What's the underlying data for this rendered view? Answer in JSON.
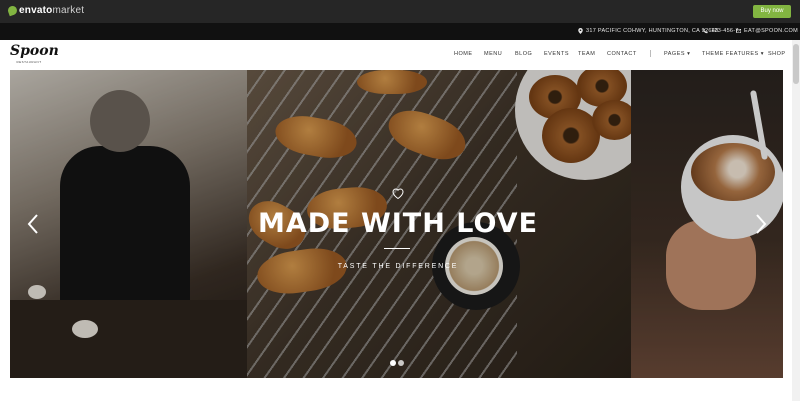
{
  "envato": {
    "brand": "envato",
    "market": "market",
    "buy_label": "Buy now",
    "brand_color": "#82b541"
  },
  "info": {
    "address": "317 PACIFIC COHWY, HUNTINGTON, CA 92648",
    "phone": "123-456-7",
    "email": "EAT@SPOON.COM"
  },
  "header": {
    "logo_main": "Spoon",
    "logo_sub": "RESTAURANT",
    "nav": [
      {
        "label": "HOME"
      },
      {
        "label": "MENU"
      },
      {
        "label": "BLOG"
      },
      {
        "label": "EVENTS"
      },
      {
        "label": "TEAM"
      },
      {
        "label": "CONTACT"
      },
      {
        "label": "PAGES ▾"
      },
      {
        "label": "THEME FEATURES ▾"
      },
      {
        "label": "SHOP"
      }
    ]
  },
  "hero": {
    "title": "MADE WITH LOVE",
    "subtitle": "TASTE THE DIFFERENCE",
    "icon": "heart-icon",
    "prev_icon": "chevron-left-icon",
    "next_icon": "chevron-right-icon",
    "slide_count": 2,
    "active_slide": 1
  }
}
